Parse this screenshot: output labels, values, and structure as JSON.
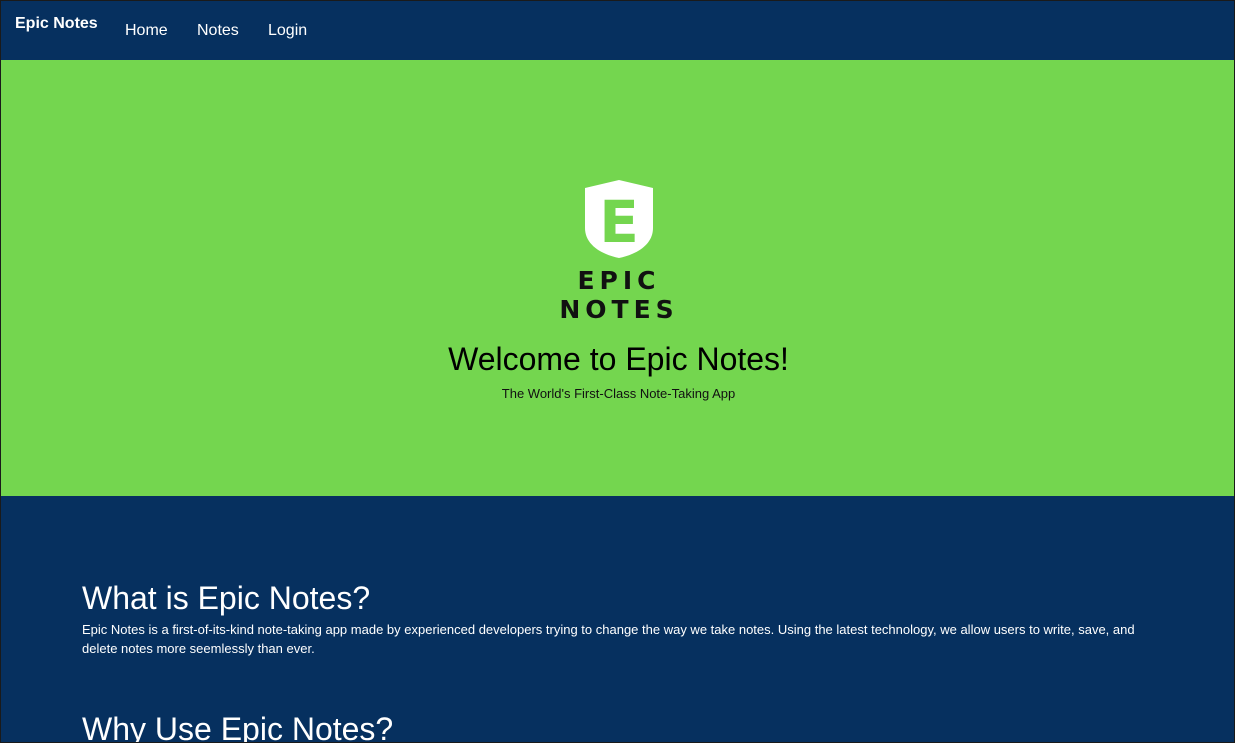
{
  "navbar": {
    "brand": "Epic Notes",
    "links": [
      {
        "label": "Home"
      },
      {
        "label": "Notes"
      },
      {
        "label": "Login"
      }
    ]
  },
  "hero": {
    "logo_text": "EPIC NOTES",
    "logo_letter": "E",
    "title": "Welcome to Epic Notes!",
    "subtitle": "The World's First-Class Note-Taking App"
  },
  "sections": [
    {
      "heading": "What is Epic Notes?",
      "body": "Epic Notes is a first-of-its-kind note-taking app made by experienced developers trying to change the way we take notes. Using the latest technology, we allow users to write, save, and delete notes more seemlessly than ever."
    },
    {
      "heading": "Why Use Epic Notes?"
    }
  ],
  "colors": {
    "navy": "#06305f",
    "green": "#74d64f"
  },
  "icons": {
    "logo": "shield-icon"
  }
}
